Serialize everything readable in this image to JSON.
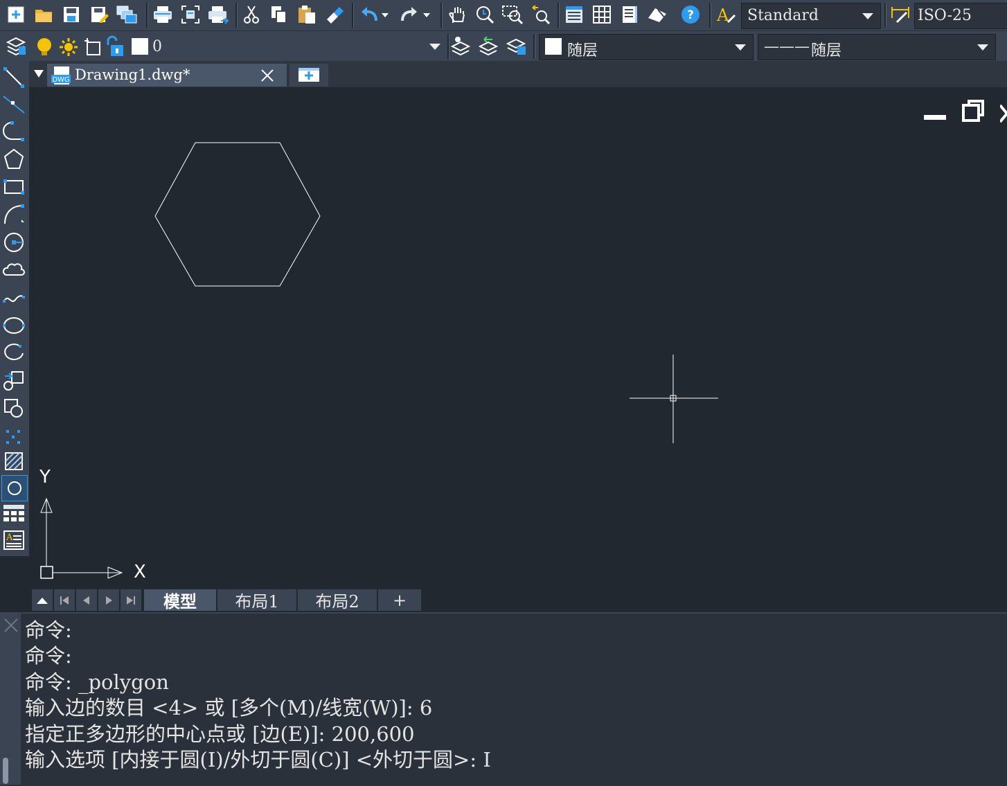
{
  "toolbar_top": {
    "icons": [
      "new-icon",
      "open-icon",
      "save-icon",
      "save-as-icon",
      "multi-window-icon",
      "plot-icon",
      "plot-preview-icon",
      "print-icon",
      "cut-icon",
      "copy-icon",
      "paste-icon",
      "match-properties-icon",
      "undo-icon",
      "redo-icon",
      "pan-icon",
      "zoom-realtime-icon",
      "zoom-window-icon",
      "zoom-previous-icon",
      "properties-icon",
      "design-center-icon",
      "tool-palette-icon",
      "markup-icon",
      "help-icon",
      "text-style-icon",
      "dim-style-icon"
    ],
    "text_style": "Standard",
    "dim_style": "ISO-25"
  },
  "toolbar_layer": {
    "layer_name": "0",
    "color_value": "随层",
    "linetype_value": "随层",
    "linetype_prefix": "———"
  },
  "document_tab": {
    "file_icon_label": "DWG",
    "title": "Drawing1.dwg*",
    "new_tab_symbol": "+"
  },
  "left_toolbar": {
    "icons": [
      "line-icon",
      "construction-line-icon",
      "polyline-icon",
      "polygon-icon",
      "rectangle-icon",
      "arc-icon",
      "circle-icon",
      "revision-cloud-icon",
      "spline-icon",
      "ellipse-icon",
      "ellipse-arc-icon",
      "insert-block-icon",
      "make-block-icon",
      "point-icon",
      "hatch-icon",
      "region-icon",
      "table-icon",
      "mtext-icon"
    ]
  },
  "ucs": {
    "x_label": "X",
    "y_label": "Y"
  },
  "layout_tabs": {
    "tabs": [
      "模型",
      "布局1",
      "布局2",
      "+"
    ],
    "active": 0
  },
  "command_history": [
    "命令:",
    "命令:",
    "命令: _polygon",
    "输入边的数目 <4> 或 [多个(M)/线宽(W)]: 6",
    "指定正多边形的中心点或 [边(E)]: 200,600",
    "输入选项 [内接于圆(I)/外切于圆(C)] <外切于圆>: I"
  ],
  "colors": {
    "canvas": "#212830",
    "toolbar": "#3b4453",
    "accent_blue": "#2c9cf0",
    "accent_yellow": "#f5c400"
  }
}
